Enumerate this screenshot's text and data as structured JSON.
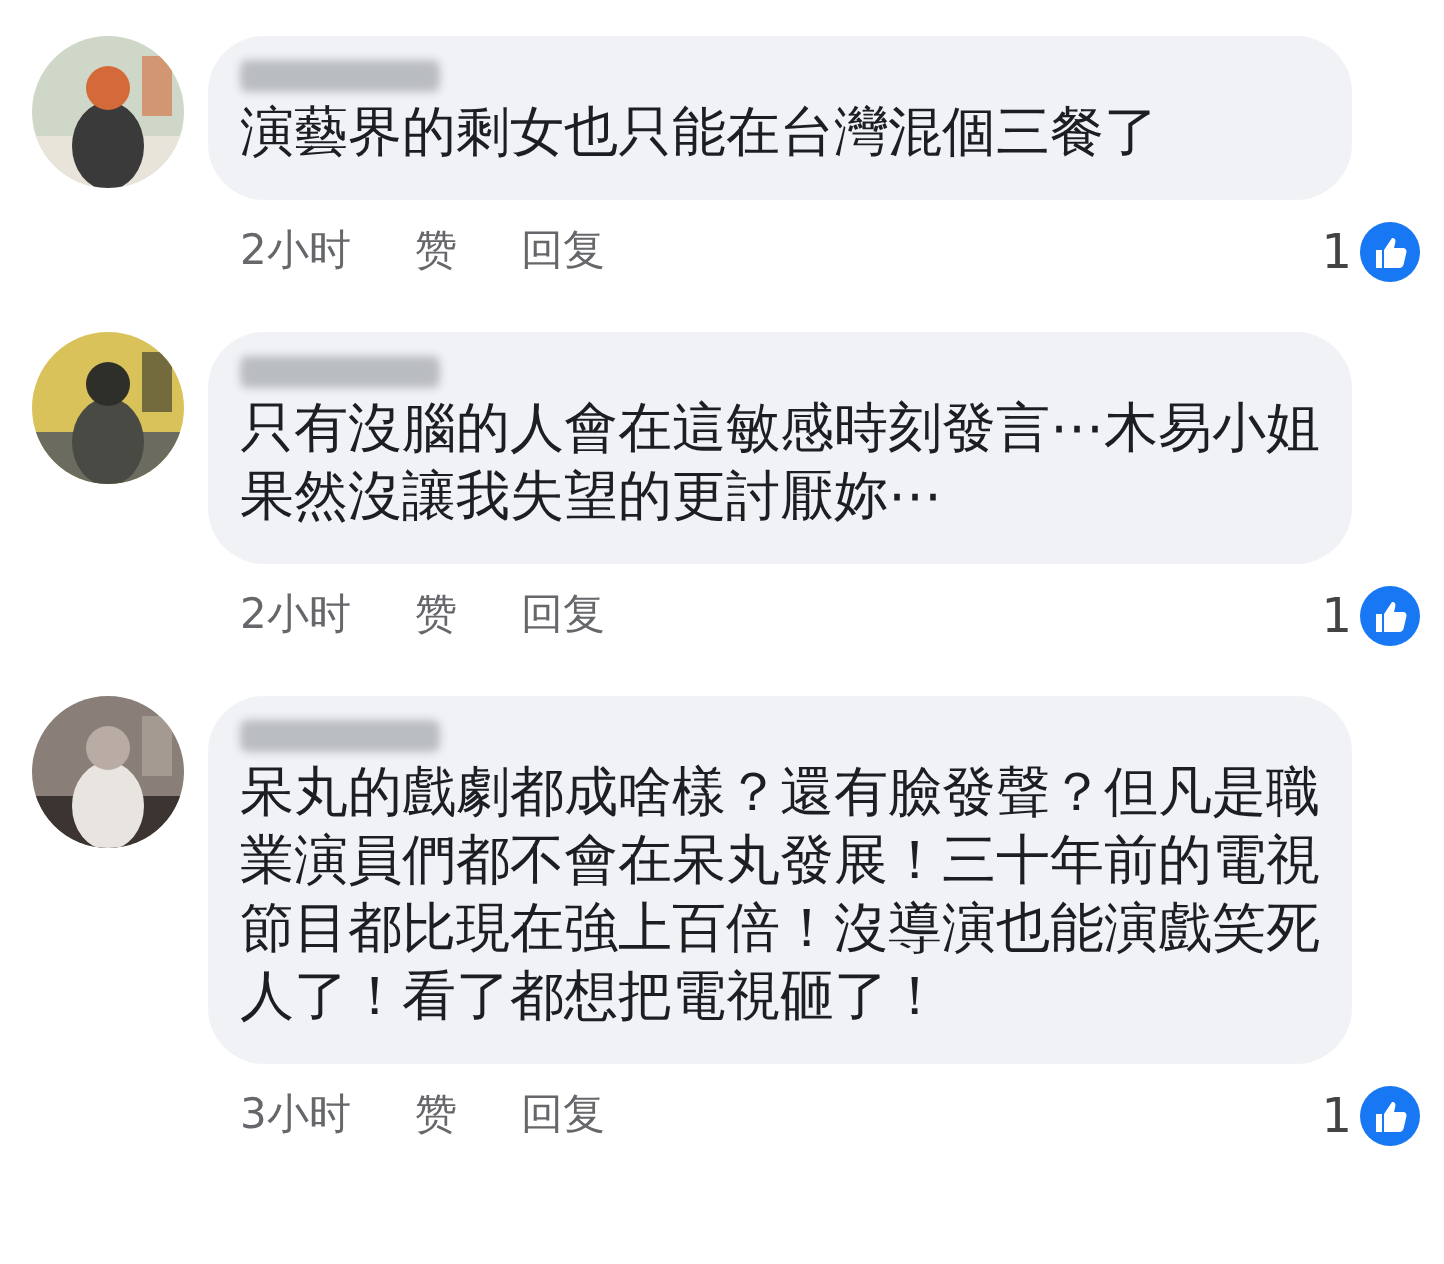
{
  "comments": [
    {
      "text": "演藝界的剩女也只能在台灣混個三餐了",
      "time": "2小时",
      "like_label": "赞",
      "reply_label": "回复",
      "reactions": "1"
    },
    {
      "text": "只有沒腦的人會在這敏感時刻發言⋯木易小姐果然沒讓我失望的更討厭妳⋯",
      "time": "2小时",
      "like_label": "赞",
      "reply_label": "回复",
      "reactions": "1"
    },
    {
      "text": "呆丸的戲劇都成啥樣？還有臉發聲？但凡是職業演員們都不會在呆丸發展！三十年前的電視節目都比現在強上百倍！沒導演也能演戲笑死人了！看了都想把電視砸了！",
      "time": "3小时",
      "like_label": "赞",
      "reply_label": "回复",
      "reactions": "1"
    }
  ]
}
